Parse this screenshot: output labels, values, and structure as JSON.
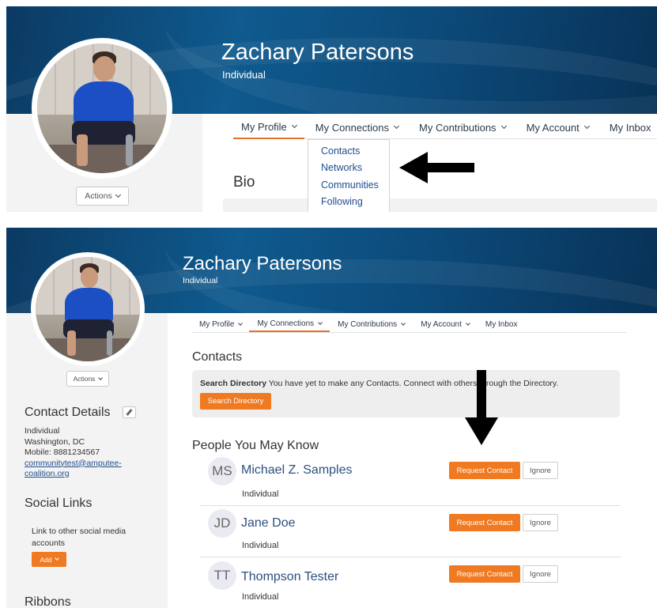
{
  "profile": {
    "name": "Zachary Patersons",
    "type": "Individual",
    "actions_label": "Actions"
  },
  "nav": {
    "items": [
      {
        "label": "My Profile"
      },
      {
        "label": "My Connections"
      },
      {
        "label": "My Contributions"
      },
      {
        "label": "My Account"
      },
      {
        "label": "My Inbox"
      }
    ]
  },
  "dropdown": {
    "items": [
      {
        "label": "Contacts"
      },
      {
        "label": "Networks"
      },
      {
        "label": "Communities"
      },
      {
        "label": "Following"
      }
    ]
  },
  "bio": {
    "title": "Bio"
  },
  "contacts": {
    "title": "Contacts",
    "search_strong": "Search Directory",
    "search_text": " You have yet to make any Contacts. Connect with others through the Directory.",
    "search_button": "Search Directory"
  },
  "people": {
    "title": "People You May Know",
    "request_label": "Request Contact",
    "ignore_label": "Ignore",
    "list": [
      {
        "initials": "MS",
        "name": "Michael Z. Samples",
        "type": "Individual"
      },
      {
        "initials": "JD",
        "name": "Jane Doe",
        "type": "Individual"
      },
      {
        "initials": "TT",
        "name": "Thompson Tester",
        "type": "Individual"
      }
    ]
  },
  "sidebar": {
    "contact_details_title": "Contact Details",
    "type": "Individual",
    "location": "Washington, DC",
    "mobile": "Mobile: 8881234567",
    "email_line1": "communitytest@amputee-",
    "email_line2": "coalition.org",
    "social_title": "Social Links",
    "social_text": "Link to other social media accounts",
    "add_label": "Add",
    "ribbons_title": "Ribbons"
  },
  "colors": {
    "banner": "#0f5a8e",
    "accent_orange": "#f07a22",
    "link_blue": "#1f4e8c"
  }
}
